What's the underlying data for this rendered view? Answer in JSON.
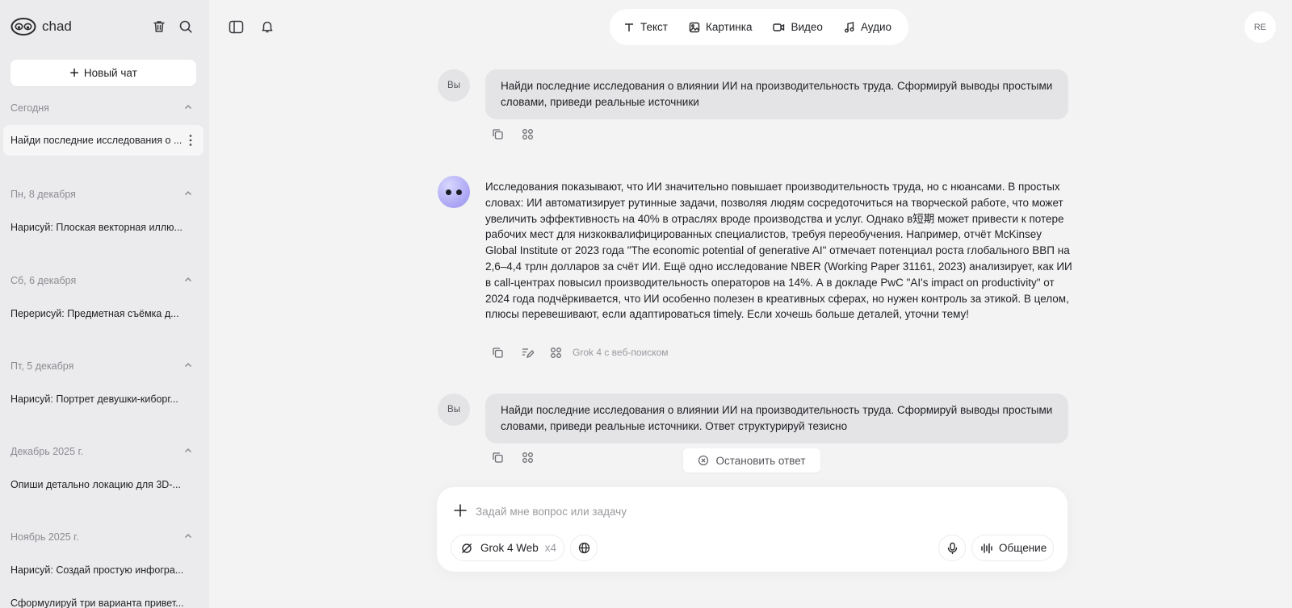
{
  "app": {
    "name": "chad"
  },
  "sidebar": {
    "new_chat_label": "Новый чат",
    "groups": [
      {
        "label": "Сегодня",
        "items": [
          "Найди последние исследования о ..."
        ]
      },
      {
        "label": "Пн, 8 декабря",
        "items": [
          "Нарисуй: Плоская векторная иллю..."
        ]
      },
      {
        "label": "Сб, 6 декабря",
        "items": [
          "Перерисуй: Предметная съёмка д..."
        ]
      },
      {
        "label": "Пт, 5 декабря",
        "items": [
          "Нарисуй: Портрет девушки-киборг..."
        ]
      },
      {
        "label": "Декабрь 2025 г.",
        "items": [
          "Опиши детально локацию для 3D-..."
        ]
      },
      {
        "label": "Ноябрь 2025 г.",
        "items": [
          "Нарисуй: Создай простую инфогра...",
          "Сформулируй три варианта привет..."
        ]
      }
    ]
  },
  "modes": [
    "Текст",
    "Картинка",
    "Видео",
    "Аудио"
  ],
  "user": {
    "initials": "RE",
    "you_label": "Вы"
  },
  "messages": {
    "q1": "Найди последние исследования о влиянии ИИ на производительность труда. Сформируй выводы простыми словами, приведи реальные источники",
    "answer": "Исследования показывают, что ИИ значительно повышает производительность труда, но с нюансами. В простых словах: ИИ автоматизирует рутинные задачи, позволяя людям сосредоточиться на творческой работе, что может увеличить эффективность на 40% в отраслях вроде производства и услуг. Однако в短期 может привести к потере рабочих мест для низкоквалифицированных специалистов, требуя переобучения. Например, отчёт McKinsey Global Institute от 2023 года \"The economic potential of generative AI\" отмечает потенциал роста глобального ВВП на 2,6–4,4 трлн долларов за счёт ИИ. Ещё одно исследование NBER (Working Paper 31161, 2023) анализирует, как ИИ в call-центрах повысил производительность операторов на 14%. А в докладе PwC \"AI's impact on productivity\" от 2024 года подчёркивается, что ИИ особенно полезен в креативных сферах, но нужен контроль за этикой. В целом, плюсы перевешивают, если адаптироваться timely. Если хочешь больше деталей, уточни тему!",
    "answer_model": "Grok 4 с веб-поиском",
    "q2": "Найди последние исследования о влиянии ИИ на производительность труда. Сформируй выводы простыми словами, приведи реальные источники. Ответ структурируй тезисно"
  },
  "stop_label": "Остановить ответ",
  "composer": {
    "placeholder": "Задай мне вопрос или задачу",
    "model": "Grok 4 Web",
    "multiplier": "x4",
    "voice_label": "Общение"
  }
}
